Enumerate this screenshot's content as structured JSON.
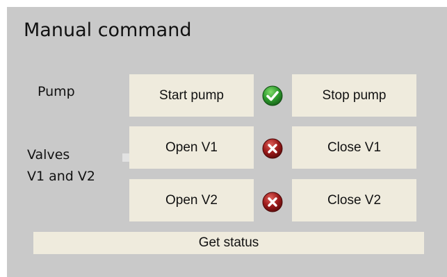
{
  "title": "Manual command",
  "labels": {
    "pump": "Pump",
    "valves_line1": "Valves",
    "valves_line2": "V1 and V2"
  },
  "buttons": {
    "start_pump": "Start pump",
    "stop_pump": "Stop pump",
    "open_v1": "Open V1",
    "close_v1": "Close V1",
    "open_v2": "Open V2",
    "close_v2": "Close V2",
    "get_status": "Get status"
  },
  "status": {
    "pump": "ok",
    "v1": "closed",
    "v2": "closed"
  },
  "colors": {
    "panel_bg": "#c9c9c9",
    "button_bg": "#efebdd",
    "ok_green": "#2e9a2e",
    "error_red": "#9c1a1a"
  },
  "icons": {
    "pump_status": "check-circle-icon",
    "v1_status": "x-circle-icon",
    "v2_status": "x-circle-icon"
  }
}
